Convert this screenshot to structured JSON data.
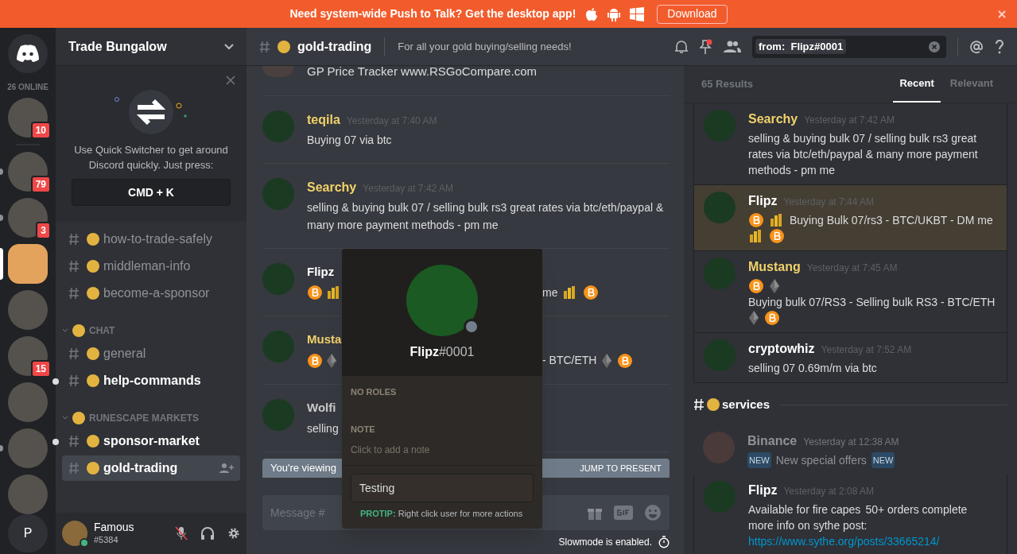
{
  "banner": {
    "text": "Need system-wide Push to Talk? Get the desktop app!",
    "button": "Download"
  },
  "servers": {
    "online": "26 ONLINE",
    "items": [
      {
        "badge": "10",
        "unread": false,
        "selected": false
      },
      {
        "badge": "79",
        "unread": true,
        "selected": false
      },
      {
        "badge": "3",
        "unread": true,
        "selected": false
      },
      {
        "unread": false,
        "selected": true
      },
      {
        "unread": false,
        "selected": false
      },
      {
        "badge": "15",
        "unread": false,
        "selected": false
      },
      {
        "unread": false,
        "selected": false
      },
      {
        "unread": true,
        "selected": false
      },
      {
        "unread": false,
        "selected": false
      }
    ],
    "user_initial": "P"
  },
  "sidebar": {
    "title": "Trade Bungalow",
    "switcher": {
      "text": "Use Quick Switcher to get around Discord quickly. Just press:",
      "key": "CMD + K"
    },
    "channels": [
      {
        "kind": "channel",
        "name": "how-to-trade-safely",
        "unread": false,
        "selected": false
      },
      {
        "kind": "channel",
        "name": "middleman-info",
        "unread": false,
        "selected": false
      },
      {
        "kind": "channel",
        "name": "become-a-sponsor",
        "unread": false,
        "selected": false
      },
      {
        "kind": "category",
        "name": "CHAT",
        "expanded": true,
        "children": [
          {
            "kind": "channel",
            "name": "general",
            "unread": false,
            "selected": false
          },
          {
            "kind": "channel",
            "name": "help-commands",
            "unread": true,
            "selected": false
          }
        ]
      },
      {
        "kind": "category",
        "name": "RUNESCAPE MARKETS",
        "expanded": true,
        "children": [
          {
            "kind": "channel",
            "name": "sponsor-market",
            "unread": true,
            "selected": false
          },
          {
            "kind": "channel",
            "name": "gold-trading",
            "unread": false,
            "selected": true
          }
        ]
      }
    ],
    "user": {
      "name": "Famous",
      "tag": "#5384",
      "online": true,
      "muted": true
    }
  },
  "header": {
    "channel": "gold-trading",
    "topic": "For all your gold buying/selling needs!",
    "search": "from:  Flipz#0001"
  },
  "messages": [
    {
      "kind": "tail",
      "text": "GP Price Tracker www.RSGoCompare.com"
    },
    {
      "kind": "full",
      "author": "teqila",
      "color": "#f1d16a",
      "time": "Yesterday at 7:40 AM",
      "text": "Buying 07 via btc"
    },
    {
      "kind": "full",
      "author": "Searchy",
      "color": "#f1d16a",
      "time": "Yesterday at 7:42 AM",
      "text": "selling & buying bulk 07 / selling bulk rs3 great rates via btc/eth/paypal & many more payment methods - pm me"
    },
    {
      "kind": "covered",
      "author": "Flipz",
      "color": "#ffffff",
      "left": [
        {
          "kind": "bitcoin"
        },
        {
          "kind": "coins"
        }
      ],
      "right": [
        {
          "kind": "text",
          "text": "me"
        },
        {
          "kind": "coins"
        },
        {
          "kind": "bitcoin"
        }
      ]
    },
    {
      "kind": "covered",
      "author": "Musta",
      "color": "#f1d16a",
      "left": [
        {
          "kind": "bitcoin"
        },
        {
          "kind": "eth"
        }
      ],
      "right": [
        {
          "kind": "text",
          "text": "- BTC/ETH"
        },
        {
          "kind": "eth"
        },
        {
          "kind": "bitcoin"
        }
      ]
    },
    {
      "kind": "covered",
      "author": "Wolfi",
      "color": "#c8c8c8",
      "left": [
        {
          "kind": "text",
          "text": "selling"
        }
      ]
    }
  ],
  "history_bar": {
    "text": "You're viewing",
    "action": "JUMP TO PRESENT"
  },
  "composer": {
    "placeholder": "Message #"
  },
  "slowmode": "Slowmode is enabled.",
  "popup": {
    "name": "Flipz",
    "tag": "#0001",
    "online": false,
    "roles": "NO ROLES",
    "note_label": "NOTE",
    "note_placeholder": "Click to add a note",
    "input": "Testing",
    "protip_label": "PROTIP:",
    "protip": "Right click user for more actions"
  },
  "search": {
    "count": "65 Results",
    "tabs": [
      {
        "label": "Recent",
        "selected": true
      },
      {
        "label": "Relevant",
        "selected": false
      }
    ],
    "groups": [
      {
        "results": [
          {
            "author": "Searchy",
            "color": "#f1d16a",
            "time": "Yesterday at 7:42 AM",
            "highlighted": false,
            "context": false,
            "content": [
              {
                "kind": "text",
                "text": "selling & buying bulk 07 / selling bulk rs3 great rates via btc/eth/paypal & many more payment methods - pm me"
              }
            ]
          },
          {
            "author": "Flipz",
            "color": "#ffffff",
            "time": "Yesterday at 7:44 AM",
            "highlighted": true,
            "context": false,
            "content": [
              {
                "kind": "bitcoin"
              },
              {
                "kind": "coins"
              },
              {
                "kind": "text",
                "text": "Buying Bulk 07/rs3 - BTC/UKBT - DM me"
              },
              {
                "kind": "coins"
              },
              {
                "kind": "bitcoin"
              }
            ]
          },
          {
            "author": "Mustang",
            "color": "#f1d16a",
            "time": "Yesterday at 7:45 AM",
            "highlighted": false,
            "context": false,
            "content": [
              {
                "kind": "bitcoin"
              },
              {
                "kind": "eth"
              },
              {
                "kind": "text",
                "text": "Buying bulk 07/RS3 - Selling bulk RS3 - BTC/ETH"
              },
              {
                "kind": "eth"
              },
              {
                "kind": "bitcoin"
              }
            ]
          },
          {
            "author": "cryptowhiz",
            "color": "#ffffff",
            "time": "Yesterday at 7:52 AM",
            "highlighted": false,
            "context": false,
            "content": [
              {
                "kind": "text",
                "text": "selling 07 0.69m/m via btc"
              }
            ]
          }
        ]
      },
      {
        "channel": "services",
        "results": [
          {
            "author": "Binance",
            "color": "#8e9297",
            "time": "Yesterday at 12:38 AM",
            "highlighted": false,
            "context": true,
            "content": [
              {
                "kind": "badge",
                "text": "NEW"
              },
              {
                "kind": "text",
                "text": "New special offers"
              },
              {
                "kind": "badge",
                "text": "NEW"
              }
            ]
          },
          {
            "author": "Flipz",
            "color": "#ffffff",
            "time": "Yesterday at 2:08 AM",
            "highlighted": false,
            "context": false,
            "content": [
              {
                "kind": "line",
                "text": "Available for fire capes"
              },
              {
                "kind": "line",
                "text": "50+ orders complete"
              },
              {
                "kind": "line",
                "text": "more info on sythe post:"
              },
              {
                "kind": "link",
                "text": "https://www.sythe.org/posts/33665214/"
              }
            ]
          }
        ]
      }
    ]
  }
}
